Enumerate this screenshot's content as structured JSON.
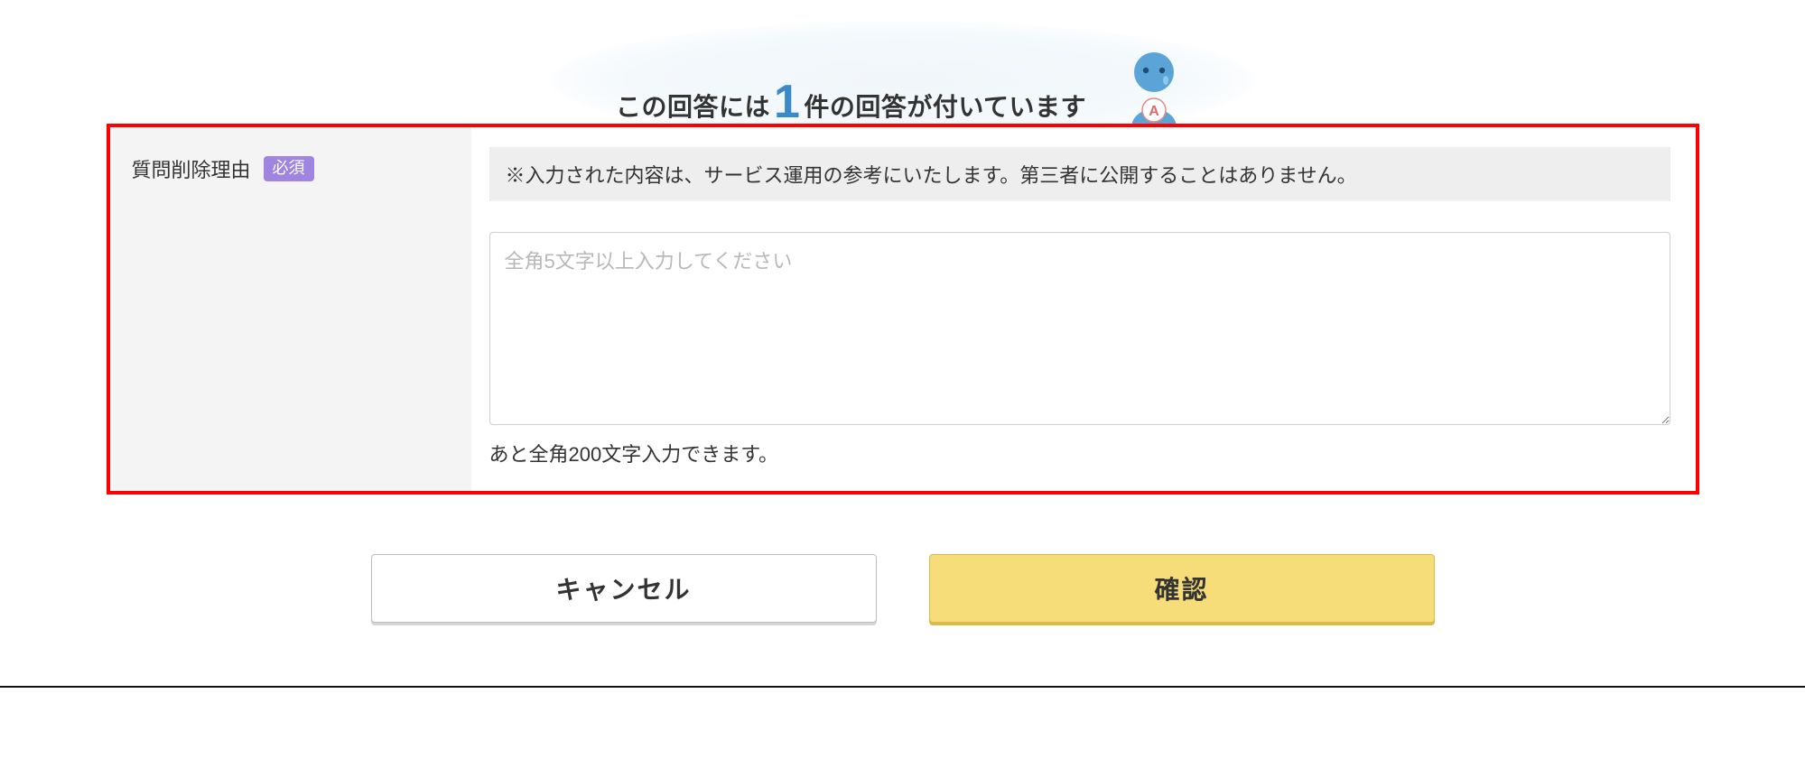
{
  "banner": {
    "prefix": "この回答には",
    "count": "1",
    "suffix": "件の回答が付いています"
  },
  "form": {
    "label": "質問削除理由",
    "required_badge": "必須",
    "notice": "※入力された内容は、サービス運用の参考にいたします。第三者に公開することはありません。",
    "placeholder": "全角5文字以上入力してください",
    "char_hint": "あと全角200文字入力できます。"
  },
  "buttons": {
    "cancel": "キャンセル",
    "confirm": "確認"
  }
}
